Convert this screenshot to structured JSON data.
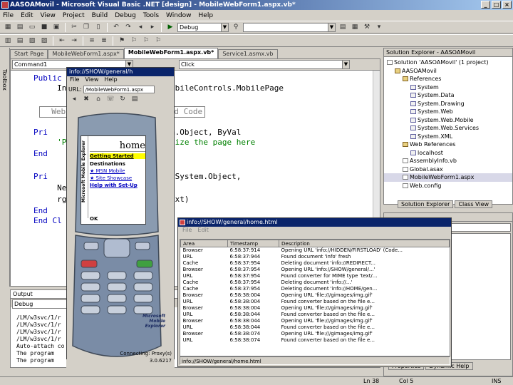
{
  "window": {
    "title": "AASOAMovil - Microsoft Visual Basic .NET [design] - MobileWebForm1.aspx.vb*"
  },
  "menu": [
    "File",
    "Edit",
    "View",
    "Project",
    "Build",
    "Debug",
    "Tools",
    "Window",
    "Help"
  ],
  "toolbar": {
    "config": "Debug"
  },
  "tabs": [
    "Start Page",
    "MobileWebForm1.aspx*",
    "MobileWebForm1.aspx.vb*",
    "Service1.asmx.vb"
  ],
  "editor": {
    "class_combo": "Command1",
    "event_combo": "Click",
    "lines": [
      {
        "kw": "Public",
        "text": " Cl"
      },
      {
        "kw": "",
        "text": "     Inherits System.Web.UI.MobileControls.MobilePage"
      },
      {
        "kw": "",
        "text": "  Web Form Designer Generated Code"
      },
      {
        "kw": "Pri",
        "text": "     ByVal sender As System.Object, ByVal"
      },
      {
        "kw": "",
        "text": "     'Put user code to initialize the page here"
      },
      {
        "kw": "End",
        "text": ""
      },
      {
        "kw": "Pri",
        "text": "     Click(ByVal sender As System.Object,"
      },
      {
        "kw": "",
        "text": "     New localhost.Service1"
      },
      {
        "kw": "",
        "text": "     rgume.Cambiar(TextBox1.Text)"
      },
      {
        "kw": "End",
        "text": ""
      },
      {
        "kw": "End Cl",
        "text": ""
      }
    ]
  },
  "toolbox": {
    "label": "Toolbox"
  },
  "output": {
    "title": "Output",
    "combo": "Debug",
    "lines": [
      "/LM/w3svc/1/r",
      "/LM/w3svc/1/r",
      "/LM/w3svc/1/r",
      "/LM/w3svc/1/r",
      "Auto-attach co",
      "The program",
      "The program"
    ]
  },
  "solution_explorer": {
    "title": "Solution Explorer - AASOAMovil",
    "items": [
      {
        "depth": 0,
        "label": "Solution 'AASOAMovil' (1 project)",
        "kind": "file"
      },
      {
        "depth": 1,
        "label": "AASOAMovil",
        "kind": "folder"
      },
      {
        "depth": 2,
        "label": "References",
        "kind": "folder"
      },
      {
        "depth": 3,
        "label": "System",
        "kind": "ref"
      },
      {
        "depth": 3,
        "label": "System.Data",
        "kind": "ref"
      },
      {
        "depth": 3,
        "label": "System.Drawing",
        "kind": "ref"
      },
      {
        "depth": 3,
        "label": "System.Web",
        "kind": "ref"
      },
      {
        "depth": 3,
        "label": "System.Web.Mobile",
        "kind": "ref"
      },
      {
        "depth": 3,
        "label": "System.Web.Services",
        "kind": "ref"
      },
      {
        "depth": 3,
        "label": "System.XML",
        "kind": "ref"
      },
      {
        "depth": 2,
        "label": "Web References",
        "kind": "folder"
      },
      {
        "depth": 3,
        "label": "localhost",
        "kind": "ref"
      },
      {
        "depth": 2,
        "label": "AssemblyInfo.vb",
        "kind": "file"
      },
      {
        "depth": 2,
        "label": "Global.asax",
        "kind": "file"
      },
      {
        "depth": 2,
        "label": "MobileWebForm1.aspx",
        "kind": "file"
      },
      {
        "depth": 2,
        "label": "Web.config",
        "kind": "file"
      }
    ],
    "tabs": [
      "Solution Explorer",
      "Class View"
    ]
  },
  "properties": {
    "tabs": [
      "Properties",
      "Dynamic Help"
    ]
  },
  "emulator": {
    "title": "info://SHOW/general/h",
    "menu": [
      "File",
      "View",
      "Help"
    ],
    "url_label": "URL:",
    "url": "/MobileWebForm1.aspx",
    "brand": "Microsoft Mobile Explorer",
    "screen": {
      "header": "home",
      "selected": "Getting Started",
      "section": "Destinations",
      "links": [
        "MSN Mobile",
        "Site Showcase",
        "Help with Set-Up"
      ],
      "softkey": "OK"
    },
    "status_left": "Connecting: Proxy(s)",
    "status_right": "3.0.6217"
  },
  "info_window": {
    "title": "info://SHOW/general/home.html",
    "menu": [
      "File",
      "Edit"
    ],
    "columns": [
      "Area",
      "Timestamp",
      "Description"
    ],
    "rows": [
      [
        "Browser",
        "6:58:37:914",
        "Opening URL 'info://HIDDEN/FIRSTLOAD' (Code..."
      ],
      [
        "URL",
        "6:58:37:944",
        "Found document 'info' fresh"
      ],
      [
        "Cache",
        "6:58:37:954",
        "Deleting document 'info://REDIRECT..."
      ],
      [
        "Browser",
        "6:58:37:954",
        "Opening URL 'info://SHOW/general/...'"
      ],
      [
        "URL",
        "6:58:37:954",
        "Found converter for MIME type 'text/..."
      ],
      [
        "Cache",
        "6:58:37:954",
        "Deleting document 'info://...'"
      ],
      [
        "Cache",
        "6:58:37:954",
        "Deleting document 'info://HOME/gen..."
      ],
      [
        "Browser",
        "6:58:38:004",
        "Opening URL 'file:///gimages/img.gif'"
      ],
      [
        "URL",
        "6:58:38:004",
        "Found converter based on the file e..."
      ],
      [
        "Browser",
        "6:58:38:004",
        "Opening URL 'file:///gimages/img.gif'"
      ],
      [
        "URL",
        "6:58:38:044",
        "Found converter based on the file e..."
      ],
      [
        "Browser",
        "6:58:38:044",
        "Opening URL 'file:///gimages/img.gif'"
      ],
      [
        "URL",
        "6:58:38:044",
        "Found converter based on the file e..."
      ],
      [
        "Browser",
        "6:58:38:074",
        "Opening URL 'file:///gimages/img.gif'"
      ],
      [
        "URL",
        "6:58:38:074",
        "Found converter based on the file e..."
      ]
    ],
    "status": "info://SHOW/general/home.html"
  },
  "statusbar": {
    "ln": "Ln 38",
    "col": "Col 5",
    "ins": "INS"
  }
}
